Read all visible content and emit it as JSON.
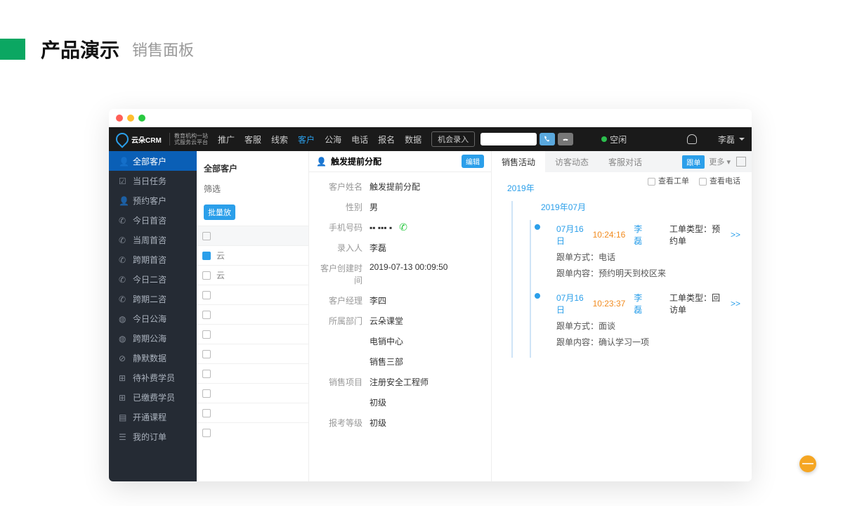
{
  "page": {
    "title": "产品演示",
    "subtitle": "销售面板"
  },
  "topnav": {
    "brand": "云朵CRM",
    "brand_sub1": "教育机构一站",
    "brand_sub2": "式服务云平台",
    "items": [
      "推广",
      "客服",
      "线索",
      "客户",
      "公海",
      "电话",
      "报名",
      "数据"
    ],
    "active_index": 3,
    "entry_btn": "机会录入",
    "status": "空闲",
    "user": "李磊"
  },
  "sidebar": {
    "items": [
      "全部客户",
      "当日任务",
      "预约客户",
      "今日首咨",
      "当周首咨",
      "跨期首咨",
      "今日二咨",
      "跨期二咨",
      "今日公海",
      "跨期公海",
      "静默数据",
      "待补费学员",
      "已缴费学员",
      "开通课程",
      "我的订单"
    ],
    "active_index": 0
  },
  "list": {
    "all_label": "全部客户",
    "filter_label": "筛选",
    "bulk_label": "批量放",
    "col": "云",
    "rows": [
      "云",
      "云",
      "",
      "",
      "",
      "",
      "",
      "",
      ""
    ]
  },
  "detail": {
    "name_heading": "触发提前分配",
    "edit": "编辑",
    "fields": {
      "customer_name": {
        "label": "客户姓名",
        "value": "触发提前分配"
      },
      "gender": {
        "label": "性别",
        "value": "男"
      },
      "phone": {
        "label": "手机号码",
        "value": "▪▪ ▪▪▪ ▪"
      },
      "recorder": {
        "label": "录入人",
        "value": "李磊"
      },
      "created": {
        "label": "客户创建时间",
        "value": "2019-07-13 00:09:50"
      },
      "manager": {
        "label": "客户经理",
        "value": "李四"
      },
      "dept": {
        "label": "所属部门",
        "value": "云朵课堂"
      },
      "dept2": {
        "label": "",
        "value": "电销中心"
      },
      "dept3": {
        "label": "",
        "value": "销售三部"
      },
      "project": {
        "label": "销售项目",
        "value": "注册安全工程师"
      },
      "level": {
        "label": "",
        "value": "初级"
      },
      "exam_level": {
        "label": "报考等级",
        "value": "初级"
      }
    }
  },
  "activity": {
    "tabs": [
      "销售活动",
      "访客动态",
      "客服对话"
    ],
    "active_tab": 0,
    "tag": "跟单",
    "more": "更多 ▾",
    "check_ticket": "查看工单",
    "check_call": "查看电话",
    "year": "2019年",
    "month": "2019年07月",
    "cards": [
      {
        "date": "07月16日",
        "time": "10:24:16",
        "user": "李磊",
        "type_label": "工单类型：",
        "type_value": "预约单",
        "method_label": "跟单方式：",
        "method_value": "电话",
        "content_label": "跟单内容：",
        "content_value": "预约明天到校区来",
        "more": ">>"
      },
      {
        "date": "07月16日",
        "time": "10:23:37",
        "user": "李磊",
        "type_label": "工单类型：",
        "type_value": "回访单",
        "method_label": "跟单方式：",
        "method_value": "面谈",
        "content_label": "跟单内容：",
        "content_value": "确认学习一项",
        "more": ">>"
      }
    ]
  },
  "float_btn": "—"
}
